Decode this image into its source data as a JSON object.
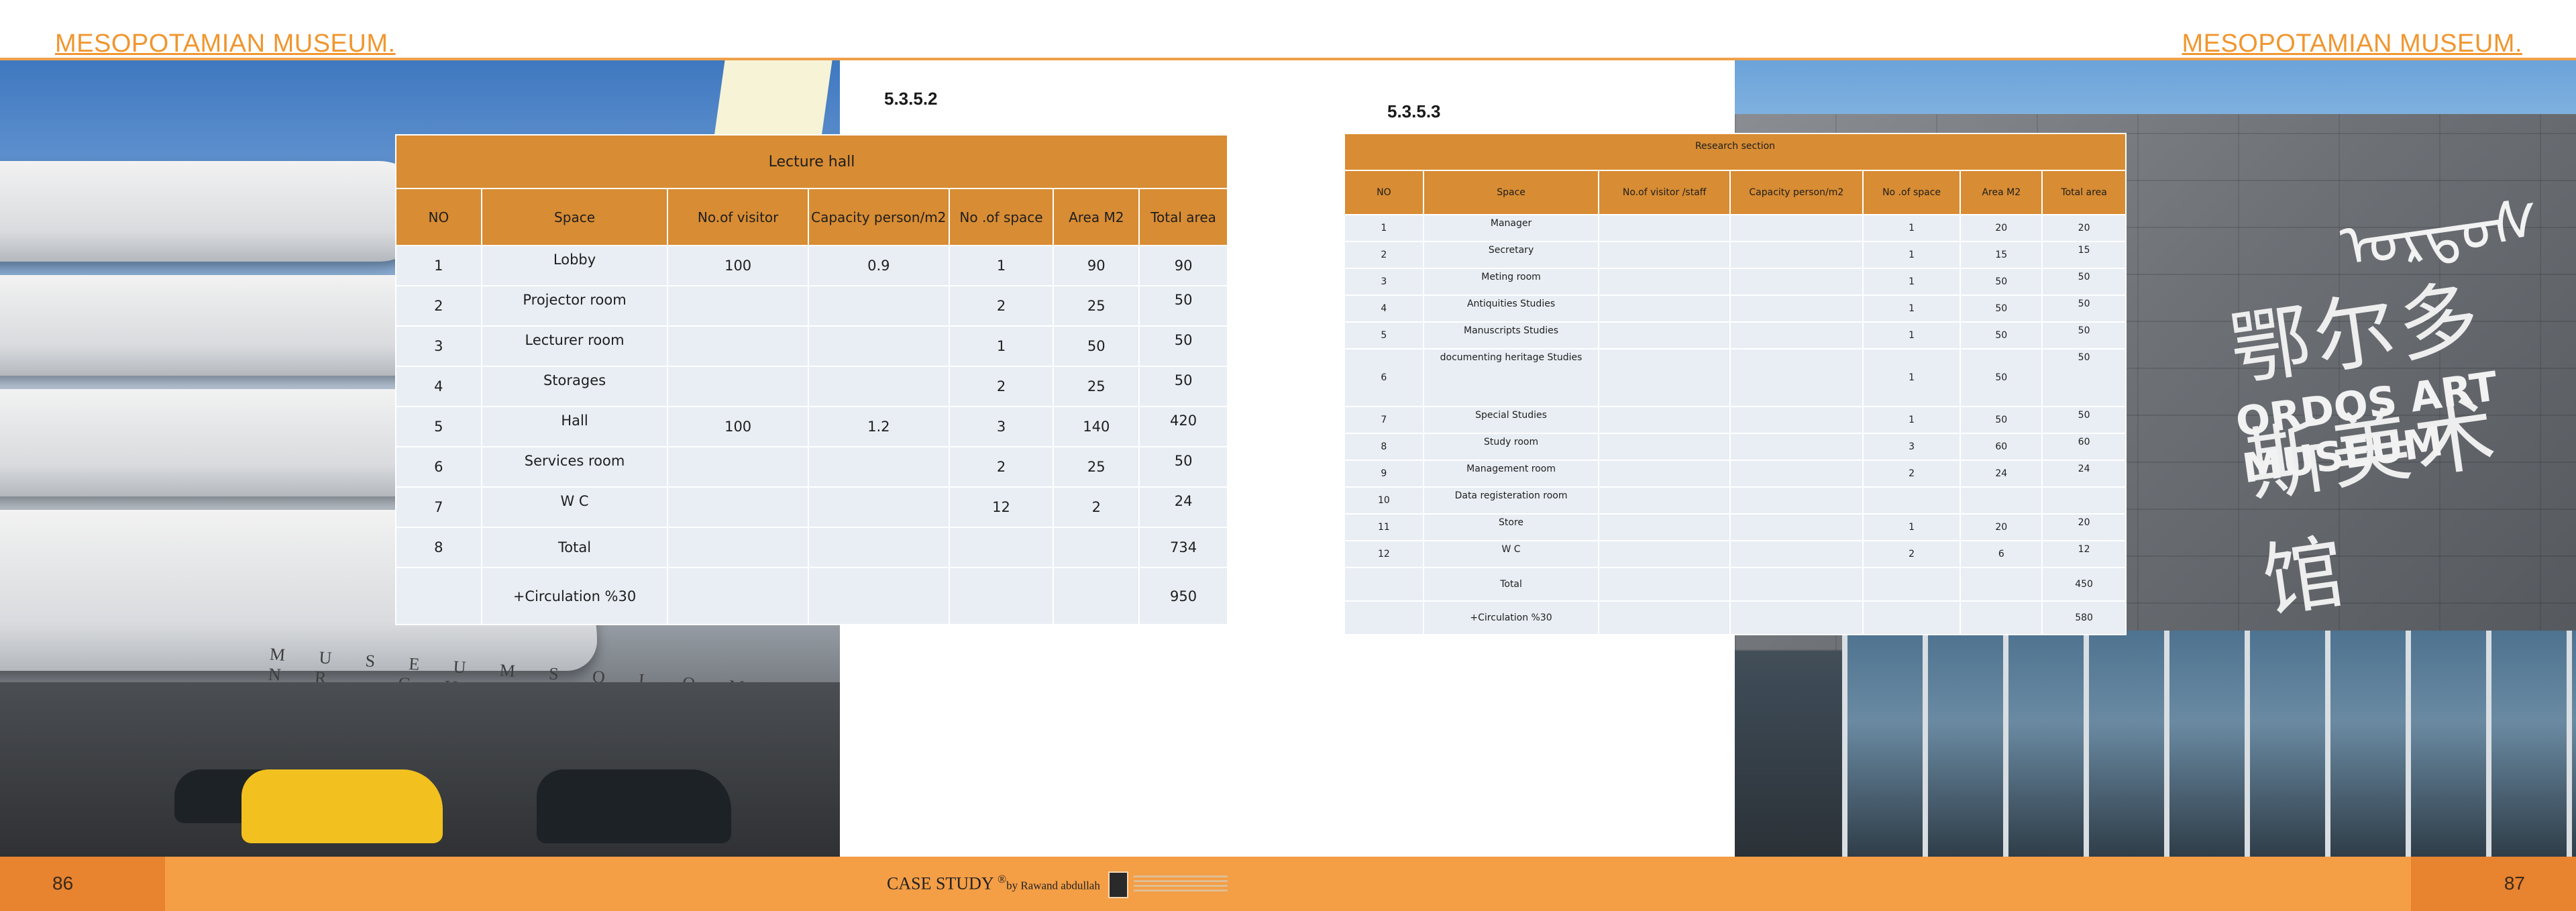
{
  "header": {
    "left_title": "MESOPOTAMIAN MUSEUM.",
    "right_title": "MESOPOTAMIAN MUSEUM."
  },
  "photos": {
    "left_building_text": "M U S E U M   S O L O M O N   R . G U G G E N H E I M",
    "right_sign_cn": "鄂尔多斯美术馆",
    "right_sign_en": "ORDOS ART MUSEUM",
    "right_sign_mn": "ᠣᠷᠳᠣᠰ"
  },
  "left_section": {
    "number": "5.3.5.2",
    "table": {
      "caption": "Lecture hall",
      "headers": [
        "NO",
        "Space",
        "No.of visitor",
        "Capacity person/m2",
        "No .of space",
        "Area M2",
        "Total area"
      ],
      "rows": [
        {
          "no": "1",
          "space": "Lobby",
          "visitors": "100",
          "capacity": "0.9",
          "num": "1",
          "area": "90",
          "total": "90"
        },
        {
          "no": "2",
          "space": "Projector room",
          "visitors": "",
          "capacity": "",
          "num": "2",
          "area": "25",
          "total": "50"
        },
        {
          "no": "3",
          "space": "Lecturer room",
          "visitors": "",
          "capacity": "",
          "num": "1",
          "area": "50",
          "total": "50"
        },
        {
          "no": "4",
          "space": "Storages",
          "visitors": "",
          "capacity": "",
          "num": "2",
          "area": "25",
          "total": "50"
        },
        {
          "no": "5",
          "space": "Hall",
          "visitors": "100",
          "capacity": "1.2",
          "num": "3",
          "area": "140",
          "total": "420"
        },
        {
          "no": "6",
          "space": "Services room",
          "visitors": "",
          "capacity": "",
          "num": "2",
          "area": "25",
          "total": "50"
        },
        {
          "no": "7",
          "space": "W C",
          "visitors": "",
          "capacity": "",
          "num": "12",
          "area": "2",
          "total": "24"
        },
        {
          "no": "8",
          "space": "Total",
          "visitors": "",
          "capacity": "",
          "num": "",
          "area": "",
          "total": "734"
        },
        {
          "no": "",
          "space": "+Circulation %30",
          "visitors": "",
          "capacity": "",
          "num": "",
          "area": "",
          "total": "950"
        }
      ]
    }
  },
  "right_section": {
    "number": "5.3.5.3",
    "table": {
      "caption": "Research section",
      "headers": [
        "NO",
        "Space",
        "No.of visitor /staff",
        "Capacity person/m2",
        "No .of space",
        "Area M2",
        "Total area"
      ],
      "rows": [
        {
          "no": "1",
          "space": "Manager",
          "staff": "",
          "capacity": "",
          "num": "1",
          "area": "20",
          "total": "20"
        },
        {
          "no": "2",
          "space": "Secretary",
          "staff": "",
          "capacity": "",
          "num": "1",
          "area": "15",
          "total": "15"
        },
        {
          "no": "3",
          "space": "Meting room",
          "staff": "",
          "capacity": "",
          "num": "1",
          "area": "50",
          "total": "50"
        },
        {
          "no": "4",
          "space": "Antiquities Studies",
          "staff": "",
          "capacity": "",
          "num": "1",
          "area": "50",
          "total": "50"
        },
        {
          "no": "5",
          "space": "Manuscripts Studies",
          "staff": "",
          "capacity": "",
          "num": "1",
          "area": "50",
          "total": "50"
        },
        {
          "no": "6",
          "space": "documenting heritage Studies",
          "staff": "",
          "capacity": "",
          "num": "1",
          "area": "50",
          "total": "50"
        },
        {
          "no": "7",
          "space": "Special Studies",
          "staff": "",
          "capacity": "",
          "num": "1",
          "area": "50",
          "total": "50"
        },
        {
          "no": "8",
          "space": "Study room",
          "staff": "",
          "capacity": "",
          "num": "3",
          "area": "60",
          "total": "60"
        },
        {
          "no": "9",
          "space": "Management room",
          "staff": "",
          "capacity": "",
          "num": "2",
          "area": "24",
          "total": "24"
        },
        {
          "no": "10",
          "space": "Data registeration room",
          "staff": "",
          "capacity": "",
          "num": "",
          "area": "",
          "total": ""
        },
        {
          "no": "11",
          "space": "Store",
          "staff": "",
          "capacity": "",
          "num": "1",
          "area": "20",
          "total": "20"
        },
        {
          "no": "12",
          "space": "W C",
          "staff": "",
          "capacity": "",
          "num": "2",
          "area": "6",
          "total": "12"
        },
        {
          "no": "",
          "space": "Total",
          "staff": "",
          "capacity": "",
          "num": "",
          "area": "",
          "total": "450"
        },
        {
          "no": "",
          "space": "+Circulation %30",
          "staff": "",
          "capacity": "",
          "num": "",
          "area": "",
          "total": "580"
        }
      ]
    }
  },
  "footer": {
    "page_left": "86",
    "page_right": "87",
    "case_study": "CASE STUDY",
    "superscript": "®",
    "author": "by Rawand abdullah"
  },
  "colors": {
    "accent": "#f0962f",
    "table_header": "#d88c33",
    "table_cell": "#e9eef4",
    "footer": "#f49e46"
  }
}
